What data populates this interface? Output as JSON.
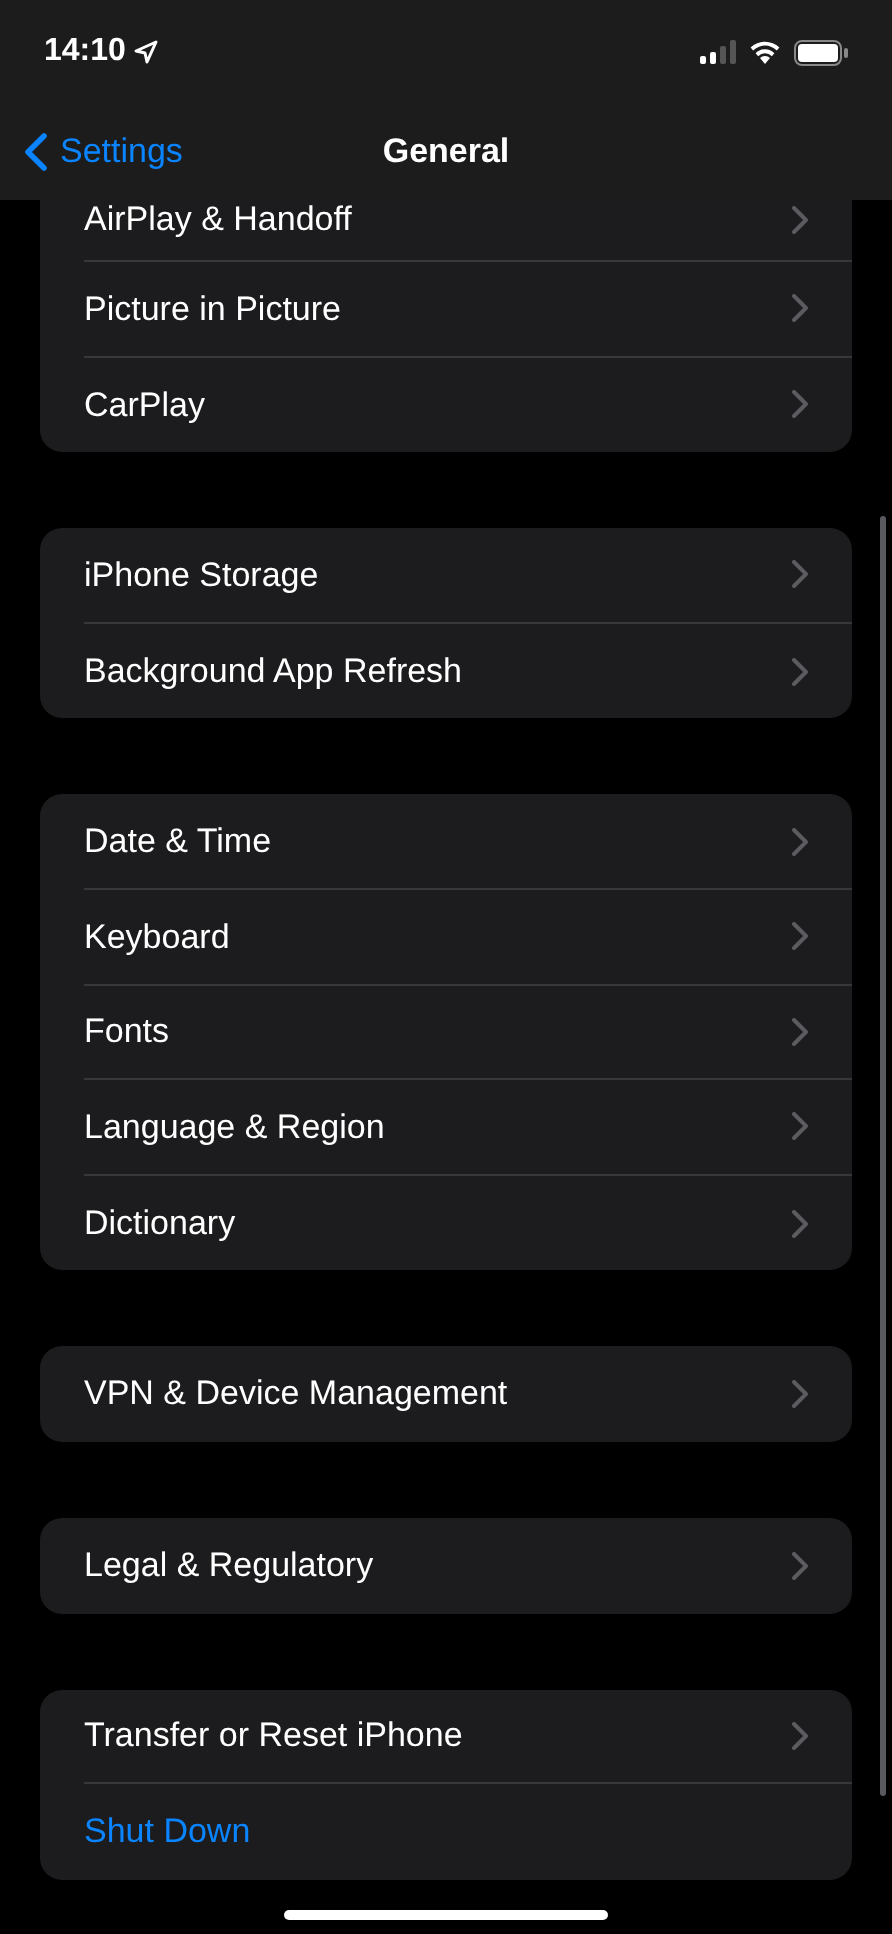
{
  "status_bar": {
    "time": "14:10"
  },
  "nav_bar": {
    "back_label": "Settings",
    "title": "General"
  },
  "groups": [
    {
      "rows": [
        {
          "label": "AirPlay & Handoff",
          "kind": "link"
        },
        {
          "label": "Picture in Picture",
          "kind": "link"
        },
        {
          "label": "CarPlay",
          "kind": "link"
        }
      ]
    },
    {
      "rows": [
        {
          "label": "iPhone Storage",
          "kind": "link"
        },
        {
          "label": "Background App Refresh",
          "kind": "link"
        }
      ]
    },
    {
      "rows": [
        {
          "label": "Date & Time",
          "kind": "link"
        },
        {
          "label": "Keyboard",
          "kind": "link"
        },
        {
          "label": "Fonts",
          "kind": "link"
        },
        {
          "label": "Language & Region",
          "kind": "link"
        },
        {
          "label": "Dictionary",
          "kind": "link"
        }
      ]
    },
    {
      "rows": [
        {
          "label": "VPN & Device Management",
          "kind": "link"
        }
      ]
    },
    {
      "rows": [
        {
          "label": "Legal & Regulatory",
          "kind": "link"
        }
      ]
    },
    {
      "rows": [
        {
          "label": "Transfer or Reset iPhone",
          "kind": "link"
        },
        {
          "label": "Shut Down",
          "kind": "action"
        }
      ]
    }
  ]
}
